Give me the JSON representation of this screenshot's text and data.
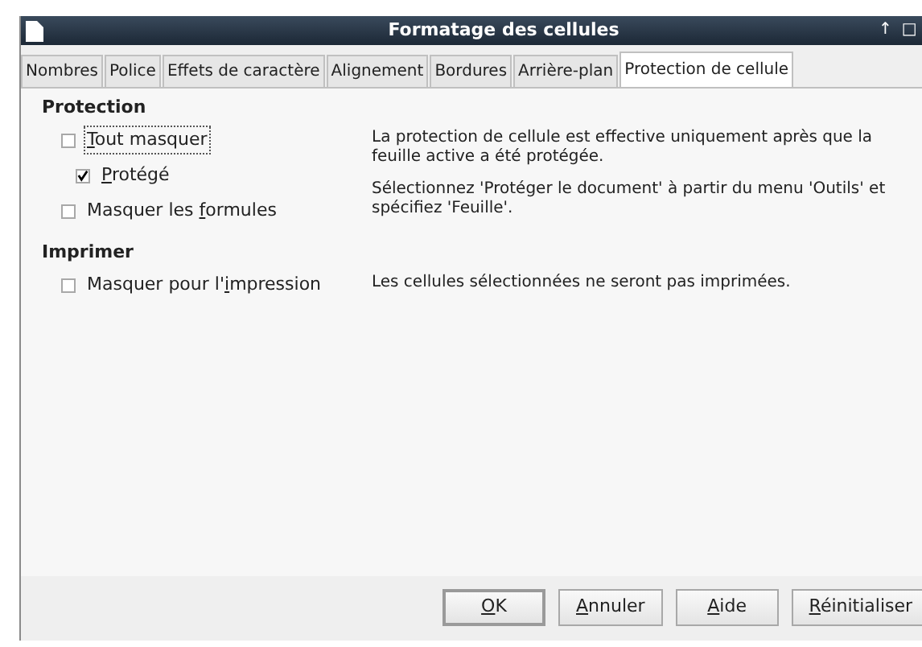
{
  "window": {
    "title": "Formatage des cellules",
    "controls": [
      "↑",
      "□"
    ]
  },
  "tabs": [
    {
      "label": "Nombres",
      "selected": false
    },
    {
      "label": "Police",
      "selected": false
    },
    {
      "label": "Effets de caractère",
      "selected": false
    },
    {
      "label": "Alignement",
      "selected": false
    },
    {
      "label": "Bordures",
      "selected": false
    },
    {
      "label": "Arrière-plan",
      "selected": false
    },
    {
      "label": "Protection de cellule",
      "selected": true
    }
  ],
  "sections": [
    {
      "heading": "Protection",
      "options": [
        {
          "label": {
            "key": "T",
            "after": "out masquer"
          },
          "checked": false,
          "focused": true,
          "children": [
            {
              "label": {
                "key": "P",
                "after": "rotégé"
              },
              "checked": true,
              "focused": false
            }
          ]
        },
        {
          "label": {
            "before": "Masquer les ",
            "key": "f",
            "after": "ormules"
          },
          "checked": false,
          "focused": false
        }
      ],
      "notes": [
        "La protection de cellule est effective uniquement après que la feuille active a été protégée.",
        "Sélectionnez 'Protéger le document' à partir du menu 'Outils' et spécifiez 'Feuille'."
      ]
    },
    {
      "heading": "Imprimer",
      "options": [
        {
          "label": {
            "before": "Masquer pour l'",
            "key": "i",
            "after": "mpression"
          },
          "checked": false,
          "focused": false
        }
      ],
      "notes": [
        "Les cellules sélectionnées ne seront pas imprimées."
      ]
    }
  ],
  "buttons": [
    {
      "label": {
        "key": "O",
        "after": "K"
      },
      "default": true
    },
    {
      "label": {
        "key": "A",
        "after": "nnuler"
      },
      "default": false
    },
    {
      "label": {
        "key": "A",
        "after": "ide"
      },
      "default": false
    },
    {
      "label": {
        "key": "R",
        "after": "éinitialiser"
      },
      "default": false
    }
  ]
}
